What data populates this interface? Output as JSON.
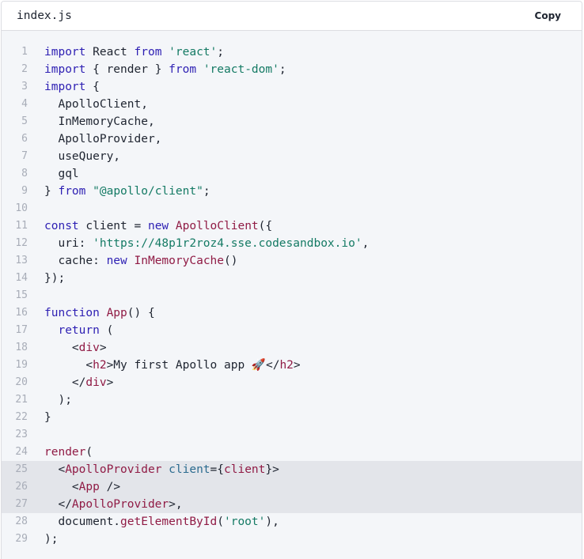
{
  "editor": {
    "filename": "index.js",
    "copy_label": "Copy",
    "highlighted_lines": [
      25,
      26,
      27
    ]
  },
  "colors": {
    "keyword": "#2d1fb3",
    "string": "#147a64",
    "function": "#901b45",
    "tag": "#901b45",
    "attribute": "#2c6b8f",
    "plain": "#1e2430",
    "line_number": "#a8adb8",
    "code_background": "#f4f6f9",
    "highlight_background": "#e3e5ea"
  },
  "code": [
    {
      "n": "1",
      "tokens": [
        {
          "t": "import",
          "c": "k"
        },
        {
          "t": " React ",
          "c": "p"
        },
        {
          "t": "from",
          "c": "k"
        },
        {
          "t": " ",
          "c": "p"
        },
        {
          "t": "'react'",
          "c": "s"
        },
        {
          "t": ";",
          "c": "p"
        }
      ]
    },
    {
      "n": "2",
      "tokens": [
        {
          "t": "import",
          "c": "k"
        },
        {
          "t": " { render } ",
          "c": "p"
        },
        {
          "t": "from",
          "c": "k"
        },
        {
          "t": " ",
          "c": "p"
        },
        {
          "t": "'react-dom'",
          "c": "s"
        },
        {
          "t": ";",
          "c": "p"
        }
      ]
    },
    {
      "n": "3",
      "tokens": [
        {
          "t": "import",
          "c": "k"
        },
        {
          "t": " {",
          "c": "p"
        }
      ]
    },
    {
      "n": "4",
      "tokens": [
        {
          "t": "  ApolloClient,",
          "c": "p"
        }
      ]
    },
    {
      "n": "5",
      "tokens": [
        {
          "t": "  InMemoryCache,",
          "c": "p"
        }
      ]
    },
    {
      "n": "6",
      "tokens": [
        {
          "t": "  ApolloProvider,",
          "c": "p"
        }
      ]
    },
    {
      "n": "7",
      "tokens": [
        {
          "t": "  useQuery,",
          "c": "p"
        }
      ]
    },
    {
      "n": "8",
      "tokens": [
        {
          "t": "  gql",
          "c": "p"
        }
      ]
    },
    {
      "n": "9",
      "tokens": [
        {
          "t": "} ",
          "c": "p"
        },
        {
          "t": "from",
          "c": "k"
        },
        {
          "t": " ",
          "c": "p"
        },
        {
          "t": "\"@apollo/client\"",
          "c": "s"
        },
        {
          "t": ";",
          "c": "p"
        }
      ]
    },
    {
      "n": "10",
      "tokens": []
    },
    {
      "n": "11",
      "tokens": [
        {
          "t": "const",
          "c": "k"
        },
        {
          "t": " client = ",
          "c": "p"
        },
        {
          "t": "new",
          "c": "k"
        },
        {
          "t": " ",
          "c": "p"
        },
        {
          "t": "ApolloClient",
          "c": "f"
        },
        {
          "t": "({",
          "c": "p"
        }
      ]
    },
    {
      "n": "12",
      "tokens": [
        {
          "t": "  uri: ",
          "c": "p"
        },
        {
          "t": "'https://48p1r2roz4.sse.codesandbox.io'",
          "c": "s"
        },
        {
          "t": ",",
          "c": "p"
        }
      ]
    },
    {
      "n": "13",
      "tokens": [
        {
          "t": "  cache: ",
          "c": "p"
        },
        {
          "t": "new",
          "c": "k"
        },
        {
          "t": " ",
          "c": "p"
        },
        {
          "t": "InMemoryCache",
          "c": "f"
        },
        {
          "t": "()",
          "c": "p"
        }
      ]
    },
    {
      "n": "14",
      "tokens": [
        {
          "t": "});",
          "c": "p"
        }
      ]
    },
    {
      "n": "15",
      "tokens": []
    },
    {
      "n": "16",
      "tokens": [
        {
          "t": "function",
          "c": "k"
        },
        {
          "t": " ",
          "c": "p"
        },
        {
          "t": "App",
          "c": "f"
        },
        {
          "t": "() {",
          "c": "p"
        }
      ]
    },
    {
      "n": "17",
      "tokens": [
        {
          "t": "  ",
          "c": "p"
        },
        {
          "t": "return",
          "c": "k"
        },
        {
          "t": " (",
          "c": "p"
        }
      ]
    },
    {
      "n": "18",
      "tokens": [
        {
          "t": "    <",
          "c": "p"
        },
        {
          "t": "div",
          "c": "t"
        },
        {
          "t": ">",
          "c": "p"
        }
      ]
    },
    {
      "n": "19",
      "tokens": [
        {
          "t": "      <",
          "c": "p"
        },
        {
          "t": "h2",
          "c": "t"
        },
        {
          "t": ">My first Apollo app ",
          "c": "p"
        },
        {
          "t": "🚀",
          "c": "e"
        },
        {
          "t": "</",
          "c": "p"
        },
        {
          "t": "h2",
          "c": "t"
        },
        {
          "t": ">",
          "c": "p"
        }
      ]
    },
    {
      "n": "20",
      "tokens": [
        {
          "t": "    </",
          "c": "p"
        },
        {
          "t": "div",
          "c": "t"
        },
        {
          "t": ">",
          "c": "p"
        }
      ]
    },
    {
      "n": "21",
      "tokens": [
        {
          "t": "  );",
          "c": "p"
        }
      ]
    },
    {
      "n": "22",
      "tokens": [
        {
          "t": "}",
          "c": "p"
        }
      ]
    },
    {
      "n": "23",
      "tokens": []
    },
    {
      "n": "24",
      "tokens": [
        {
          "t": "render",
          "c": "f"
        },
        {
          "t": "(",
          "c": "p"
        }
      ]
    },
    {
      "n": "25",
      "tokens": [
        {
          "t": "  <",
          "c": "p"
        },
        {
          "t": "ApolloProvider",
          "c": "t"
        },
        {
          "t": " ",
          "c": "p"
        },
        {
          "t": "client",
          "c": "a"
        },
        {
          "t": "={",
          "c": "p"
        },
        {
          "t": "client",
          "c": "f"
        },
        {
          "t": "}>",
          "c": "p"
        }
      ]
    },
    {
      "n": "26",
      "tokens": [
        {
          "t": "    <",
          "c": "p"
        },
        {
          "t": "App",
          "c": "t"
        },
        {
          "t": " />",
          "c": "p"
        }
      ]
    },
    {
      "n": "27",
      "tokens": [
        {
          "t": "  </",
          "c": "p"
        },
        {
          "t": "ApolloProvider",
          "c": "t"
        },
        {
          "t": ">,",
          "c": "p"
        }
      ]
    },
    {
      "n": "28",
      "tokens": [
        {
          "t": "  document.",
          "c": "p"
        },
        {
          "t": "getElementById",
          "c": "f"
        },
        {
          "t": "(",
          "c": "p"
        },
        {
          "t": "'root'",
          "c": "s"
        },
        {
          "t": "),",
          "c": "p"
        }
      ]
    },
    {
      "n": "29",
      "tokens": [
        {
          "t": ");",
          "c": "p"
        }
      ]
    }
  ]
}
